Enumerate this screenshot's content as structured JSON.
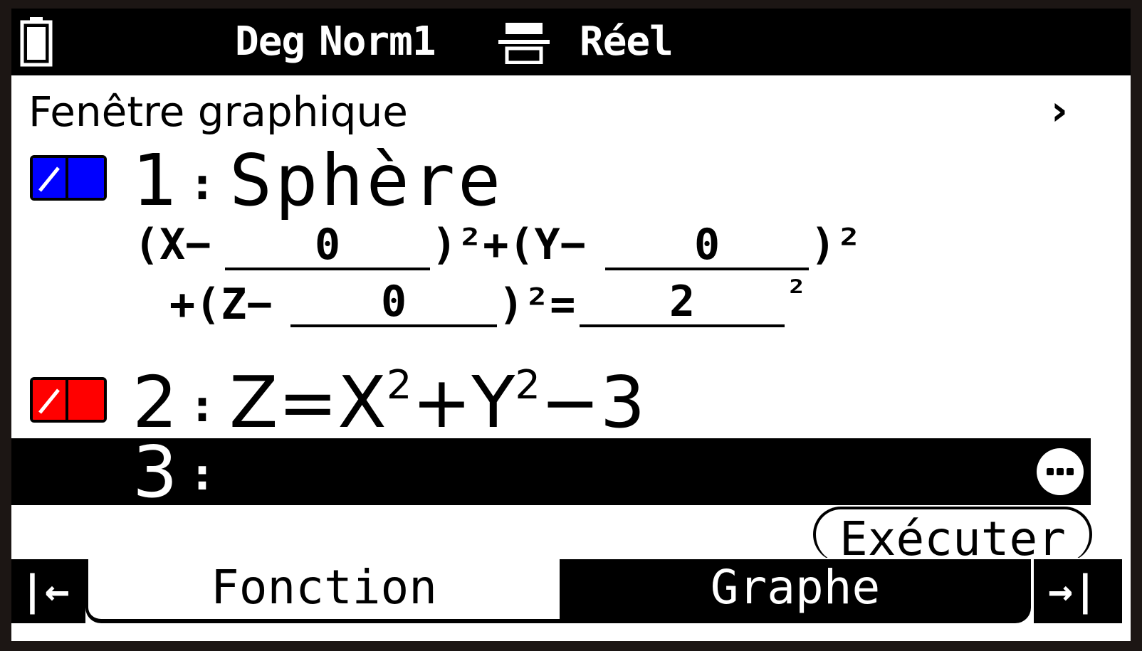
{
  "status_bar": {
    "angle_mode": "Deg",
    "display_mode": "Norm1",
    "complex_mode": "Réel",
    "battery_icon": "battery-icon",
    "input_mode_icon": "math-input-icon"
  },
  "header": {
    "title": "Fenêtre graphique",
    "chevron": "›"
  },
  "functions": [
    {
      "number": "1",
      "colon": ":",
      "color": "#0000ff",
      "expression": "Sphère",
      "template": {
        "line1_a": "(X−",
        "x0": "0",
        "line1_b": ")²+(Y−",
        "y0": "0",
        "line1_c": ")²",
        "line2_a": "+(Z−",
        "z0": "0",
        "line2_b": ")²=",
        "r": "2",
        "line2_c": "²"
      }
    },
    {
      "number": "2",
      "colon": ":",
      "color": "#ff0000",
      "expr_base": "Z=X",
      "expr_exp1": "2",
      "expr_mid": "+Y",
      "expr_exp2": "2",
      "expr_end": "−3"
    },
    {
      "number": "3",
      "colon": ":",
      "selected": true
    }
  ],
  "buttons": {
    "execute": "Exécuter",
    "more_icon": "more-icon"
  },
  "tabs": {
    "left_nav": "|←",
    "function": "Fonction",
    "graph": "Graphe",
    "right_nav": "→|"
  }
}
